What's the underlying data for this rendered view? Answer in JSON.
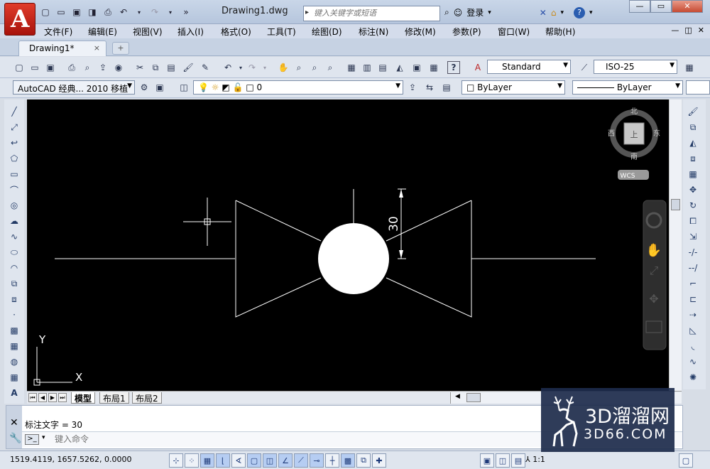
{
  "title_bar": {
    "window_title": "Drawing1.dwg",
    "search_placeholder": "键入关键字或短语",
    "login_label": "登录",
    "quick_access_icons": [
      "new-icon",
      "open-icon",
      "save-icon",
      "save-as-icon",
      "print-icon",
      "undo-icon",
      "redo-icon"
    ]
  },
  "menu": {
    "items": [
      "文件(F)",
      "编辑(E)",
      "视图(V)",
      "插入(I)",
      "格式(O)",
      "工具(T)",
      "绘图(D)",
      "标注(N)",
      "修改(M)",
      "参数(P)",
      "窗口(W)",
      "帮助(H)"
    ]
  },
  "tabs": {
    "active_tab": "Drawing1*",
    "close_glyph": "×"
  },
  "toolbar": {
    "text_style": "Standard",
    "dim_style": "ISO-25",
    "workspace": "AutoCAD 经典... 2010 移植",
    "layer": "0",
    "color": "ByLayer",
    "linetype": "ByLayer"
  },
  "viewcube": {
    "north": "北",
    "south": "南",
    "east": "东",
    "west": "西",
    "top_face": "上",
    "wcs_label": "WCS"
  },
  "drawing": {
    "dimension_text": "30",
    "ucs_x": "X",
    "ucs_y": "Y"
  },
  "layout_tabs": [
    "模型",
    "布局1",
    "布局2"
  ],
  "command": {
    "history_line": "标注文字 = 30",
    "input_placeholder": "键入命令"
  },
  "status": {
    "coordinates": "1519.4119,  1657.5262,  0.0000",
    "annotation_scale": "1:1"
  },
  "watermark": {
    "title": "3D溜溜网",
    "domain": "3D66.COM"
  },
  "colors": {
    "canvas_background": "#000000",
    "geometry": "#ffffff",
    "app_logo": "#c62115",
    "watermark_bg": "#1e2c4c"
  }
}
